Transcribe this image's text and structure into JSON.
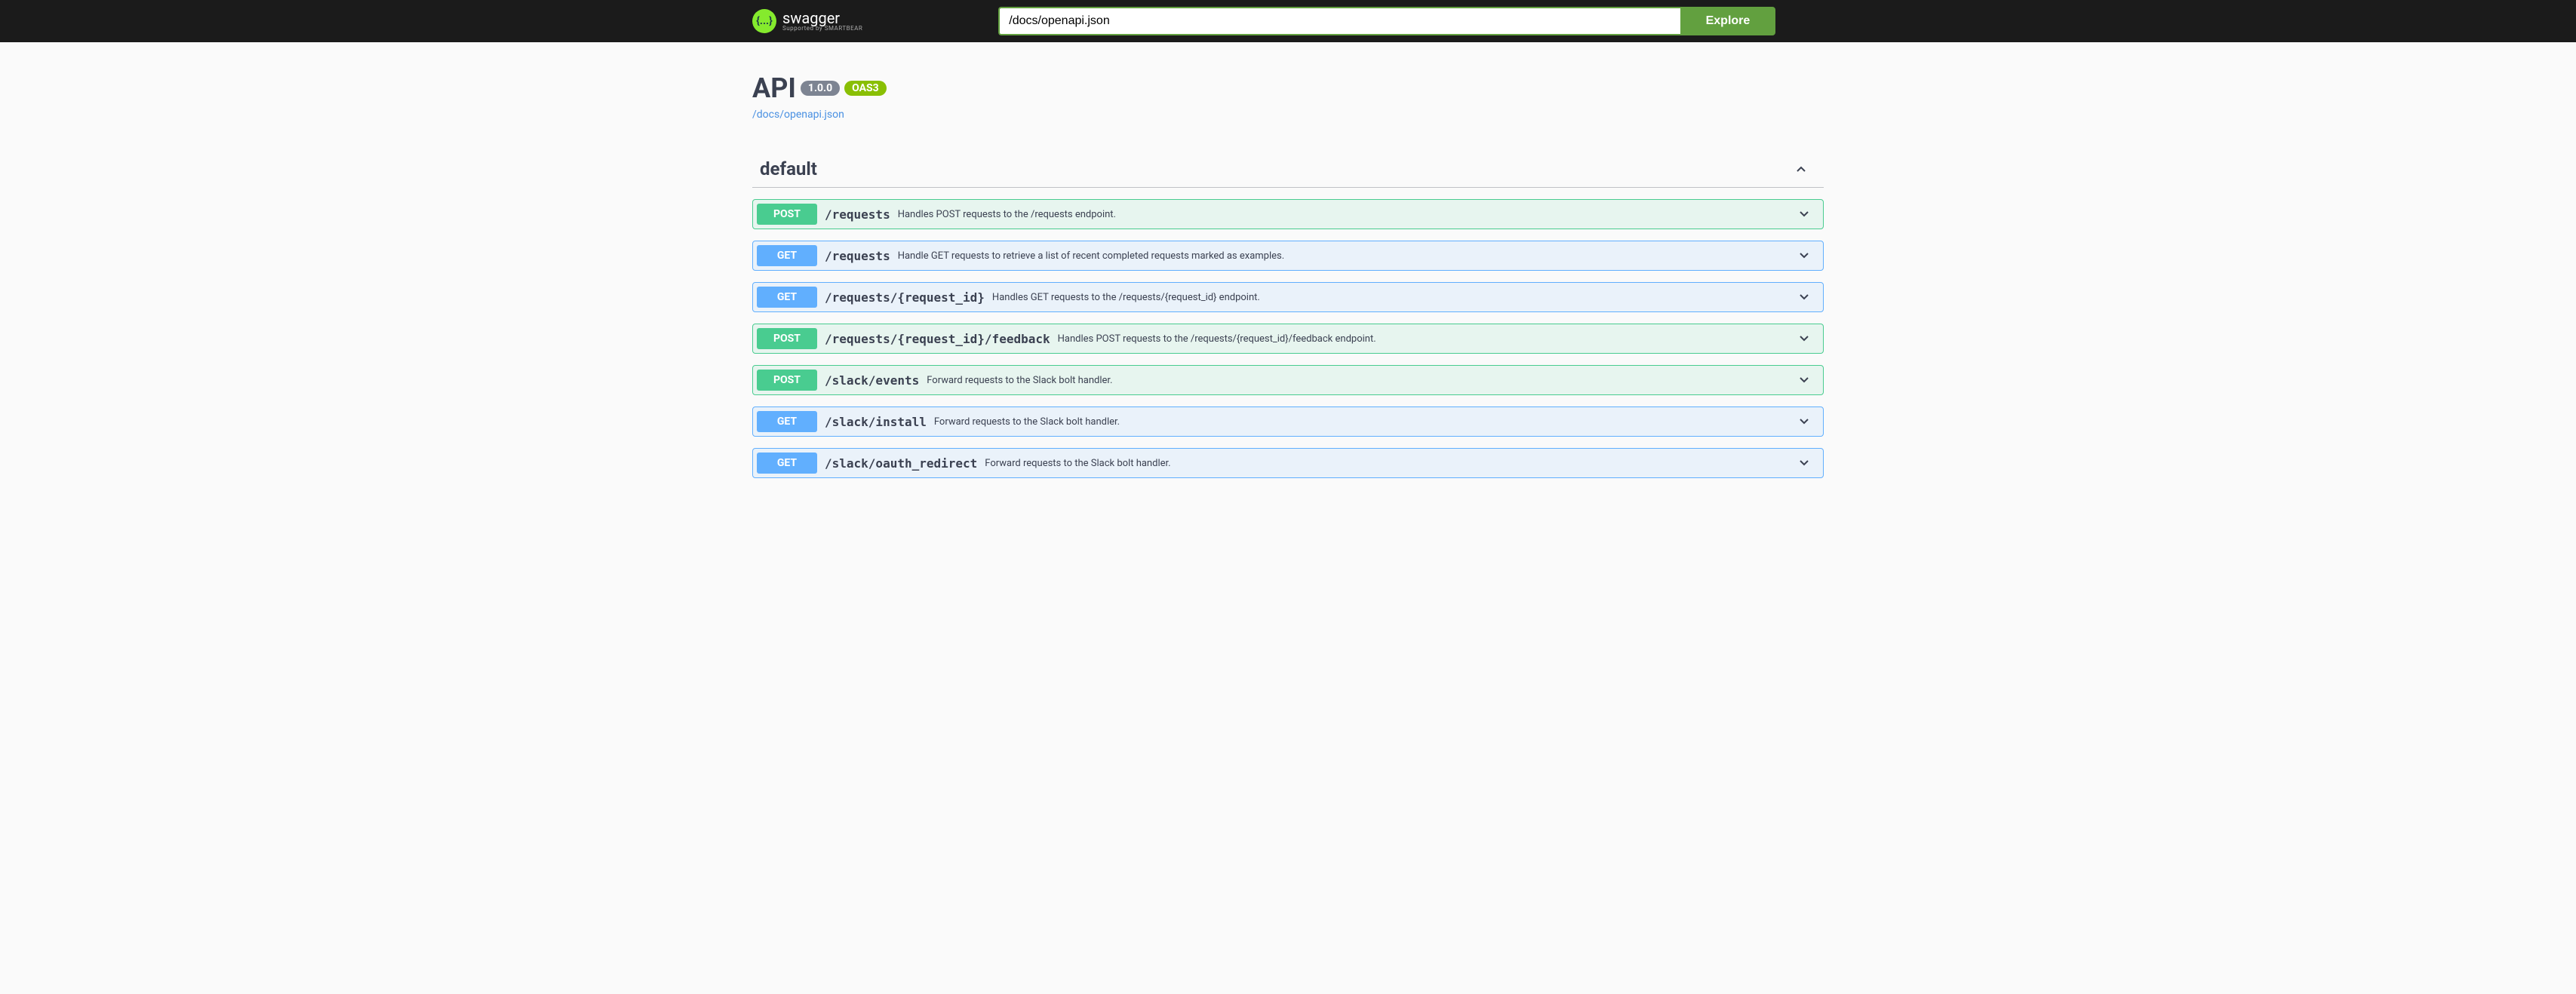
{
  "topbar": {
    "logo_text": "swagger",
    "logo_sub": "Supported by SMARTBEAR",
    "input_value": "/docs/openapi.json",
    "explore_label": "Explore"
  },
  "info": {
    "title": "API",
    "version": "1.0.0",
    "oas": "OAS3",
    "spec_url": "/docs/openapi.json"
  },
  "section": {
    "name": "default"
  },
  "operations": [
    {
      "method": "POST",
      "method_class": "post",
      "path": "/requests",
      "summary": "Handles POST requests to the /requests endpoint."
    },
    {
      "method": "GET",
      "method_class": "get",
      "path": "/requests",
      "summary": "Handle GET requests to retrieve a list of recent completed requests marked as examples."
    },
    {
      "method": "GET",
      "method_class": "get",
      "path": "/requests/{request_id}",
      "summary": "Handles GET requests to the /requests/{request_id} endpoint."
    },
    {
      "method": "POST",
      "method_class": "post",
      "path": "/requests/{request_id}/feedback",
      "summary": "Handles POST requests to the /requests/{request_id}/feedback endpoint."
    },
    {
      "method": "POST",
      "method_class": "post",
      "path": "/slack/events",
      "summary": "Forward requests to the Slack bolt handler."
    },
    {
      "method": "GET",
      "method_class": "get",
      "path": "/slack/install",
      "summary": "Forward requests to the Slack bolt handler."
    },
    {
      "method": "GET",
      "method_class": "get",
      "path": "/slack/oauth_redirect",
      "summary": "Forward requests to the Slack bolt handler."
    }
  ]
}
